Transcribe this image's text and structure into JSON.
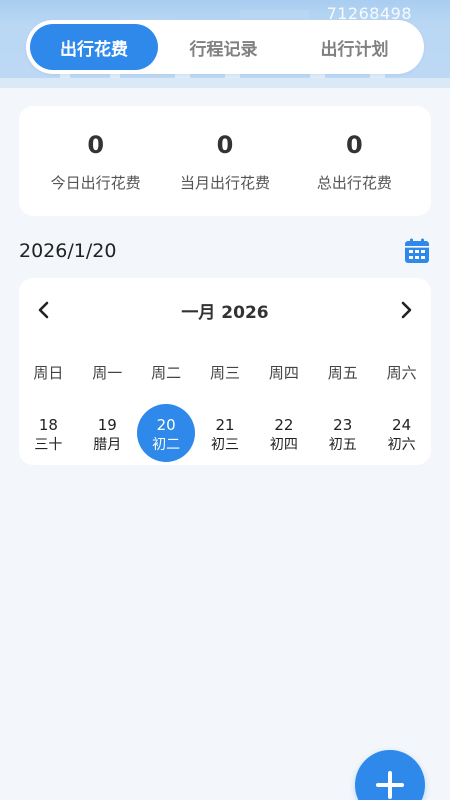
{
  "banner": {
    "number_text": "71268498"
  },
  "tabs": [
    {
      "label": "出行花费",
      "active": true
    },
    {
      "label": "行程记录",
      "active": false
    },
    {
      "label": "出行计划",
      "active": false
    }
  ],
  "stats": [
    {
      "value": "0",
      "label": "今日出行花费"
    },
    {
      "value": "0",
      "label": "当月出行花费"
    },
    {
      "value": "0",
      "label": "总出行花费"
    }
  ],
  "selected_date": "2026/1/20",
  "calendar": {
    "title": "一月 2026",
    "weekdays": [
      "周日",
      "周一",
      "周二",
      "周三",
      "周四",
      "周五",
      "周六"
    ],
    "days": [
      {
        "num": "18",
        "lunar": "三十",
        "selected": false
      },
      {
        "num": "19",
        "lunar": "腊月",
        "selected": false
      },
      {
        "num": "20",
        "lunar": "初二",
        "selected": true
      },
      {
        "num": "21",
        "lunar": "初三",
        "selected": false
      },
      {
        "num": "22",
        "lunar": "初四",
        "selected": false
      },
      {
        "num": "23",
        "lunar": "初五",
        "selected": false
      },
      {
        "num": "24",
        "lunar": "初六",
        "selected": false
      }
    ]
  },
  "colors": {
    "accent": "#2f89ea",
    "background": "#f3f6fa",
    "card": "#ffffff"
  },
  "icons": {
    "calendar": "calendar-icon",
    "prev": "chevron-left-icon",
    "next": "chevron-right-icon",
    "add": "plus-icon"
  }
}
